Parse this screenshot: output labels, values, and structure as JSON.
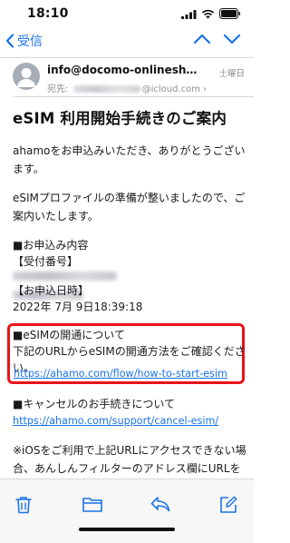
{
  "status_bar": {
    "time": "18:10"
  },
  "nav": {
    "back_label": "受信"
  },
  "header": {
    "sender": "info@docomo-onlineshop.n...",
    "date": "土曜日",
    "recipient_label": "宛先:",
    "recipient_domain": "@icloud.com"
  },
  "subject": "eSIM 利用開始手続きのご案内",
  "body": {
    "greeting_1": "ahamoをお申込みいただき、ありがとうござい",
    "greeting_2": "ます。",
    "prep_1": "eSIMプロファイルの準備が整いましたので、ご",
    "prep_2": "案内いたします。",
    "order_heading": "■お申込み内容",
    "receipt_label": "【受付番号】",
    "date_label": "【お申込日時】",
    "order_date": "2022年 7月 9日18:39:18",
    "esim_heading": "■eSIMの開通について",
    "esim_text_1": "下記のURLからeSIMの開通方法をご確認くださ",
    "esim_text_2": "い。",
    "esim_link": "https://ahamo.com/flow/how-to-start-esim",
    "cancel_heading": "■キャンセルのお手続きについて",
    "cancel_link": "https://ahamo.com/support/cancel-esim/",
    "ios_note_1": "※iOSをご利用で上記URLにアクセスできない場",
    "ios_note_2": "合、あんしんフィルターのアドレス欄にURLを"
  },
  "colors": {
    "accent": "#1a73e8",
    "highlight": "#e8141a"
  },
  "toolbar": {
    "icons": [
      "trash-icon",
      "folder-icon",
      "reply-icon",
      "compose-icon"
    ]
  }
}
